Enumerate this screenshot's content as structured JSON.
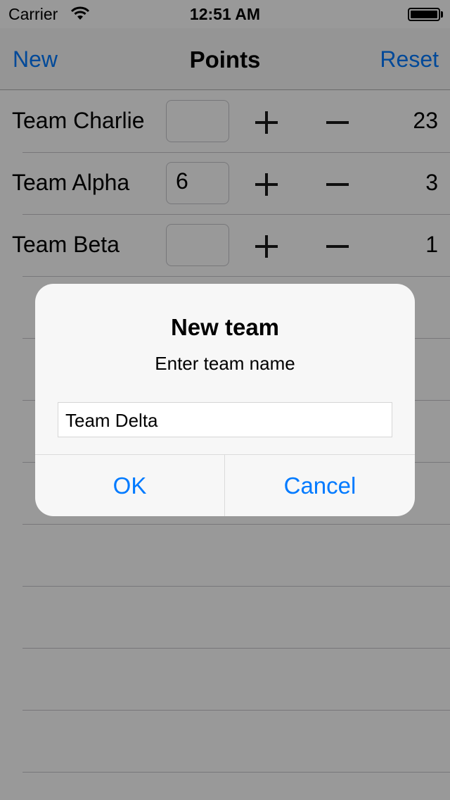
{
  "status_bar": {
    "carrier": "Carrier",
    "time": "12:51 AM",
    "icons": [
      "wifi-icon",
      "battery-icon"
    ]
  },
  "nav": {
    "left_label": "New",
    "title": "Points",
    "right_label": "Reset"
  },
  "teams": [
    {
      "name": "Team Charlie",
      "input_value": "",
      "score": "23"
    },
    {
      "name": "Team Alpha",
      "input_value": "6",
      "score": "3"
    },
    {
      "name": "Team Beta",
      "input_value": "",
      "score": "1"
    }
  ],
  "row_icons": {
    "plus": "plus-icon",
    "minus": "minus-icon"
  },
  "alert": {
    "title": "New team",
    "message": "Enter team name",
    "input_value": "Team Delta",
    "ok_label": "OK",
    "cancel_label": "Cancel"
  },
  "colors": {
    "accent": "#007aff",
    "dim_overlay": "rgba(0,0,0,0.4)",
    "alert_background": "#f7f7f7"
  }
}
